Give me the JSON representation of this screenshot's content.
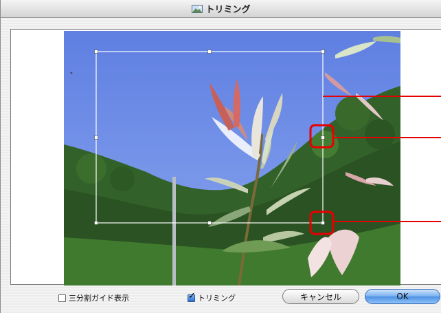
{
  "window": {
    "title": "トリミング",
    "title_icon": "image-icon"
  },
  "options": {
    "grid_guide_label": "三分割ガイド表示",
    "grid_guide_checked": false,
    "trim_label": "トリミング",
    "trim_checked": true
  },
  "buttons": {
    "cancel_label": "キャンセル",
    "ok_label": "OK"
  },
  "colors": {
    "sky": "#6f8fe8",
    "foliage": "#2f5a22",
    "crop_frame": "#ffffff",
    "callout": "#e60000",
    "ok_button": "#5a98e8"
  }
}
